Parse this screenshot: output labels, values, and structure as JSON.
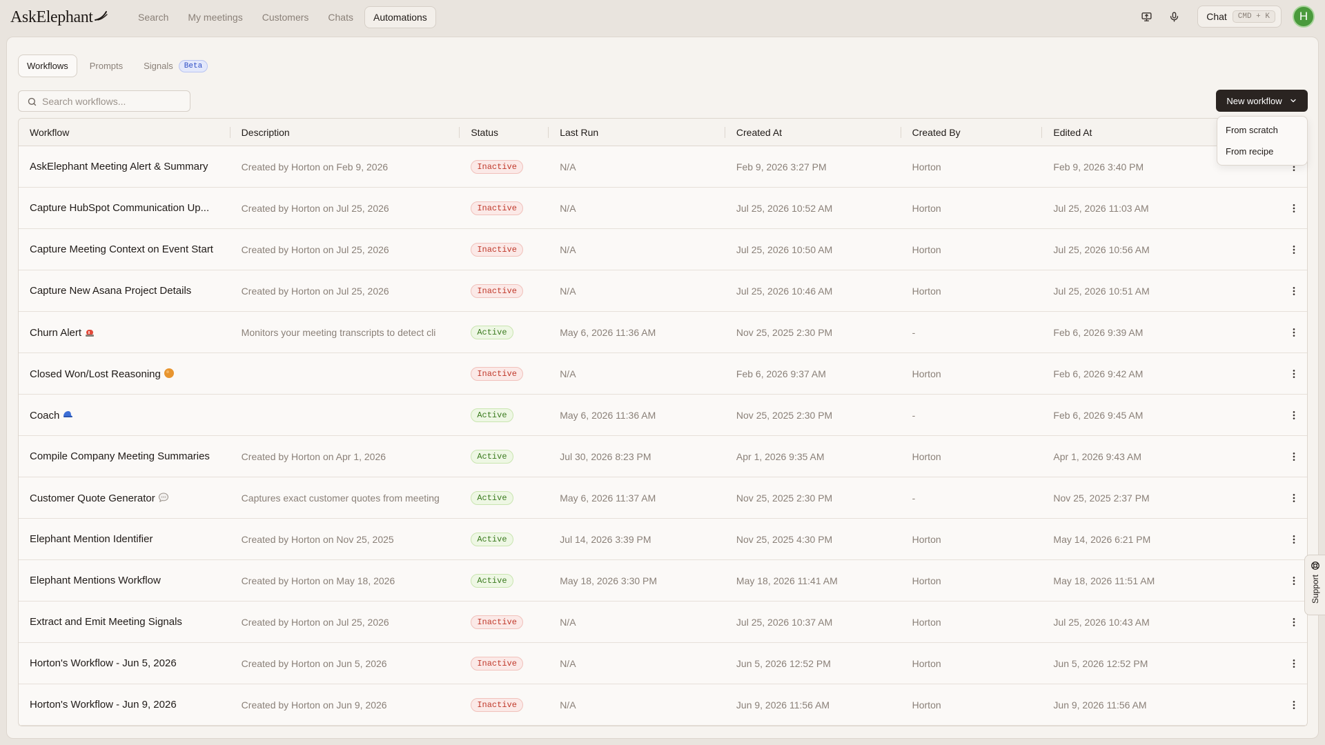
{
  "brand": {
    "name": "AskElephant"
  },
  "nav": [
    {
      "label": "Search",
      "active": false
    },
    {
      "label": "My meetings",
      "active": false
    },
    {
      "label": "Customers",
      "active": false
    },
    {
      "label": "Chats",
      "active": false
    },
    {
      "label": "Automations",
      "active": true
    }
  ],
  "topbar": {
    "chat_label": "Chat",
    "chat_shortcut": "CMD + K",
    "avatar_initial": "H"
  },
  "tabs": [
    {
      "label": "Workflows",
      "active": true
    },
    {
      "label": "Prompts",
      "active": false
    },
    {
      "label": "Signals",
      "active": false,
      "badge": "Beta"
    }
  ],
  "search": {
    "placeholder": "Search workflows..."
  },
  "new_workflow": {
    "label": "New workflow",
    "options": [
      "From scratch",
      "From recipe"
    ]
  },
  "table": {
    "columns": [
      "Workflow",
      "Description",
      "Status",
      "Last Run",
      "Created At",
      "Created By",
      "Edited At"
    ],
    "rows": [
      {
        "name": "AskElephant Meeting Alert & Summary",
        "icon": "",
        "description": "Created by Horton on Feb 9, 2026",
        "status": "Inactive",
        "last_run": "N/A",
        "created_at": "Feb 9, 2026 3:27 PM",
        "created_by": "Horton",
        "edited_at": "Feb 9, 2026 3:40 PM"
      },
      {
        "name": "Capture HubSpot Communication Up...",
        "icon": "",
        "description": "Created by Horton on Jul 25, 2026",
        "status": "Inactive",
        "last_run": "N/A",
        "created_at": "Jul 25, 2026 10:52 AM",
        "created_by": "Horton",
        "edited_at": "Jul 25, 2026 11:03 AM"
      },
      {
        "name": "Capture Meeting Context on Event Start",
        "icon": "",
        "description": "Created by Horton on Jul 25, 2026",
        "status": "Inactive",
        "last_run": "N/A",
        "created_at": "Jul 25, 2026 10:50 AM",
        "created_by": "Horton",
        "edited_at": "Jul 25, 2026 10:56 AM"
      },
      {
        "name": "Capture New Asana Project Details",
        "icon": "",
        "description": "Created by Horton on Jul 25, 2026",
        "status": "Inactive",
        "last_run": "N/A",
        "created_at": "Jul 25, 2026 10:46 AM",
        "created_by": "Horton",
        "edited_at": "Jul 25, 2026 10:51 AM"
      },
      {
        "name": "Churn Alert",
        "icon": "siren-emoji",
        "description": "Monitors your meeting transcripts to detect cli",
        "status": "Active",
        "last_run": "May 6, 2026 11:36 AM",
        "created_at": "Nov 25, 2025 2:30 PM",
        "created_by": "-",
        "edited_at": "Feb 6, 2026 9:39 AM"
      },
      {
        "name": "Closed Won/Lost Reasoning",
        "icon": "orange-circle-emoji",
        "description": "",
        "status": "Inactive",
        "last_run": "N/A",
        "created_at": "Feb 6, 2026 9:37 AM",
        "created_by": "Horton",
        "edited_at": "Feb 6, 2026 9:42 AM"
      },
      {
        "name": "Coach",
        "icon": "cap-emoji",
        "description": "",
        "status": "Active",
        "last_run": "May 6, 2026 11:36 AM",
        "created_at": "Nov 25, 2025 2:30 PM",
        "created_by": "-",
        "edited_at": "Feb 6, 2026 9:45 AM"
      },
      {
        "name": "Compile Company Meeting Summaries",
        "icon": "",
        "description": "Created by Horton on Apr 1, 2026",
        "status": "Active",
        "last_run": "Jul 30, 2026 8:23 PM",
        "created_at": "Apr 1, 2026 9:35 AM",
        "created_by": "Horton",
        "edited_at": "Apr 1, 2026 9:43 AM"
      },
      {
        "name": "Customer Quote Generator",
        "icon": "speech-bubble-emoji",
        "description": "Captures exact customer quotes from meeting",
        "status": "Active",
        "last_run": "May 6, 2026 11:37 AM",
        "created_at": "Nov 25, 2025 2:30 PM",
        "created_by": "-",
        "edited_at": "Nov 25, 2025 2:37 PM"
      },
      {
        "name": "Elephant Mention Identifier",
        "icon": "",
        "description": "Created by Horton on Nov 25, 2025",
        "status": "Active",
        "last_run": "Jul 14, 2026 3:39 PM",
        "created_at": "Nov 25, 2025 4:30 PM",
        "created_by": "Horton",
        "edited_at": "May 14, 2026 6:21 PM"
      },
      {
        "name": "Elephant Mentions Workflow",
        "icon": "",
        "description": "Created by Horton on May 18, 2026",
        "status": "Active",
        "last_run": "May 18, 2026 3:30 PM",
        "created_at": "May 18, 2026 11:41 AM",
        "created_by": "Horton",
        "edited_at": "May 18, 2026 11:51 AM"
      },
      {
        "name": "Extract and Emit Meeting Signals",
        "icon": "",
        "description": "Created by Horton on Jul 25, 2026",
        "status": "Inactive",
        "last_run": "N/A",
        "created_at": "Jul 25, 2026 10:37 AM",
        "created_by": "Horton",
        "edited_at": "Jul 25, 2026 10:43 AM"
      },
      {
        "name": "Horton's Workflow - Jun 5, 2026",
        "icon": "",
        "description": "Created by Horton on Jun 5, 2026",
        "status": "Inactive",
        "last_run": "N/A",
        "created_at": "Jun 5, 2026 12:52 PM",
        "created_by": "Horton",
        "edited_at": "Jun 5, 2026 12:52 PM"
      },
      {
        "name": "Horton's Workflow - Jun 9, 2026",
        "icon": "",
        "description": "Created by Horton on Jun 9, 2026",
        "status": "Inactive",
        "last_run": "N/A",
        "created_at": "Jun 9, 2026 11:56 AM",
        "created_by": "Horton",
        "edited_at": "Jun 9, 2026 11:56 AM"
      }
    ]
  },
  "support": {
    "label": "Support"
  },
  "colors": {
    "active": "#3a7a1e",
    "inactive": "#c0392b",
    "primary_button": "#2a2421",
    "avatar": "#4a9a3c",
    "beta": "#2f4ec4"
  }
}
